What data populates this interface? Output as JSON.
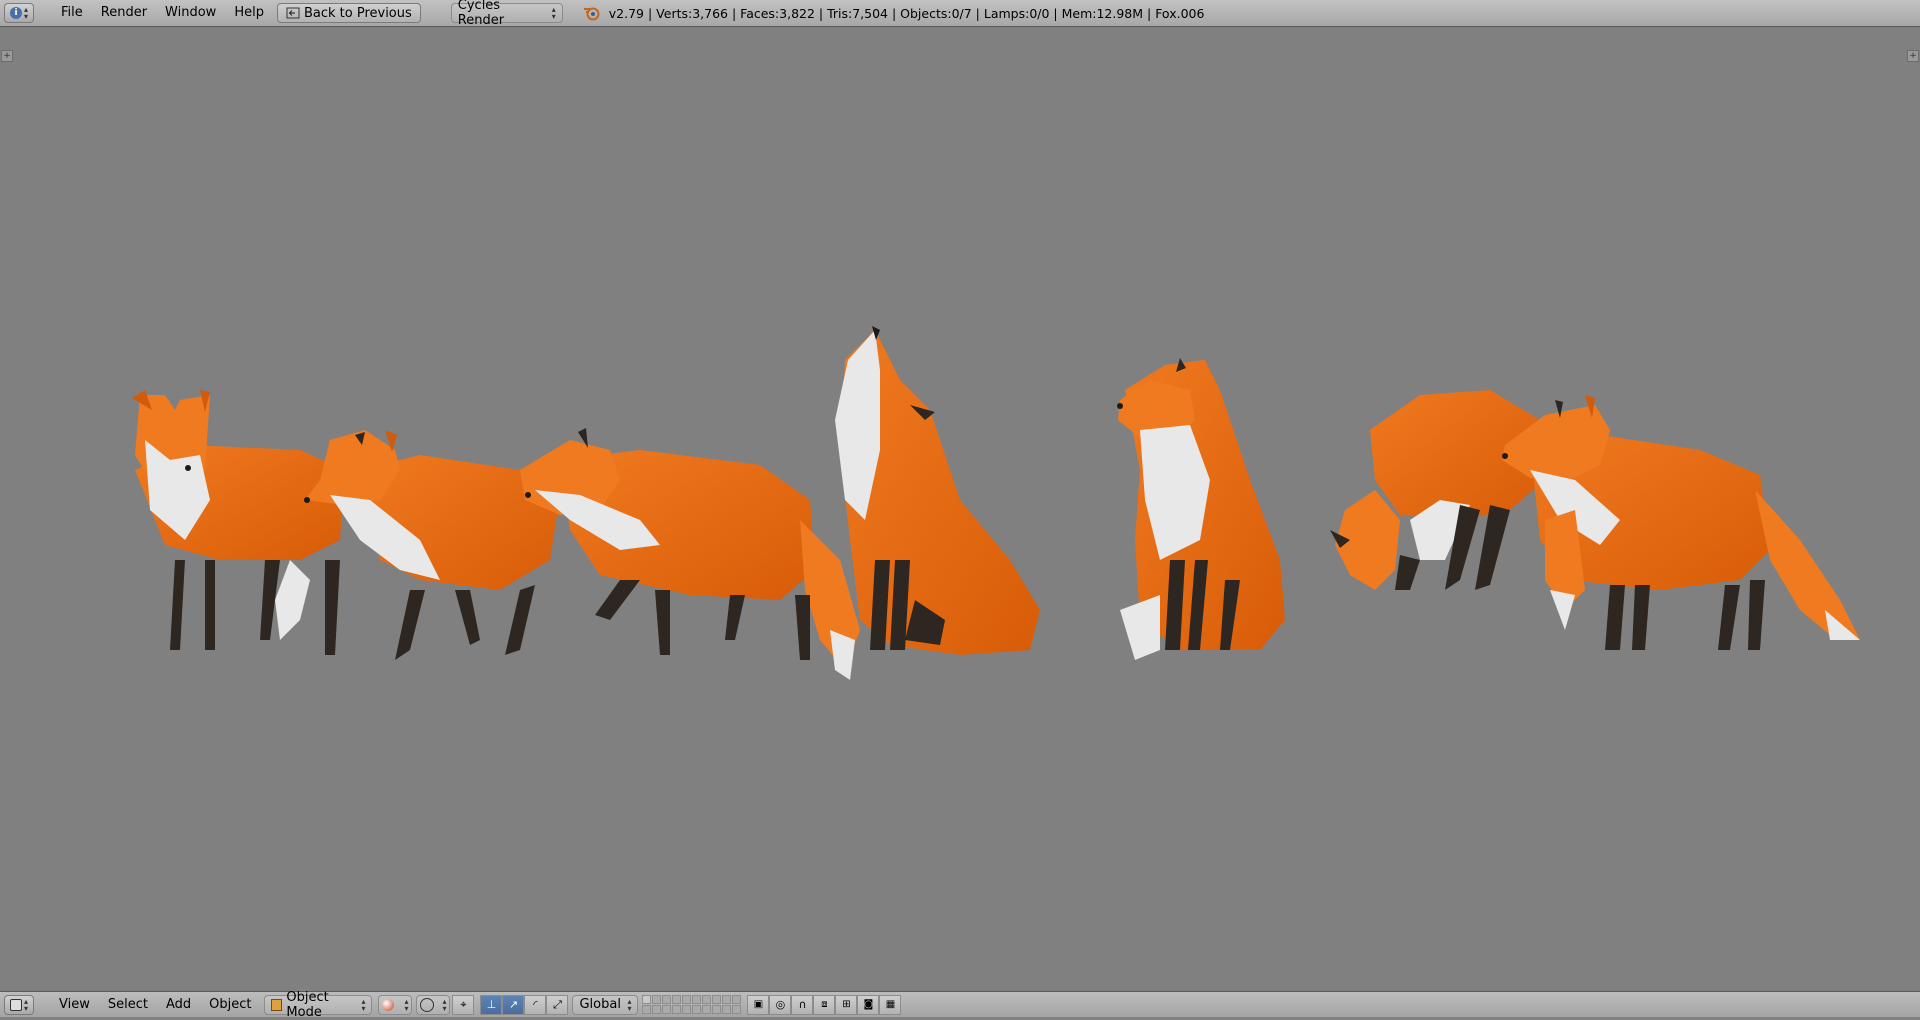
{
  "top_bar": {
    "menus": [
      "File",
      "Render",
      "Window",
      "Help"
    ],
    "back_button": "Back to Previous",
    "render_engine": "Cycles Render",
    "stats": "v2.79 | Verts:3,766 | Faces:3,822 | Tris:7,504 | Objects:0/7 | Lamps:0/0 | Mem:12.98M | Fox.006"
  },
  "bottom_bar": {
    "menus": [
      "View",
      "Select",
      "Add",
      "Object"
    ],
    "mode": "Object Mode",
    "orientation": "Global"
  },
  "viewport": {
    "background_color": "#808080",
    "fox_colors": {
      "fur": "#e86a10",
      "white": "#e8e8e8",
      "legs": "#2e2620"
    }
  }
}
